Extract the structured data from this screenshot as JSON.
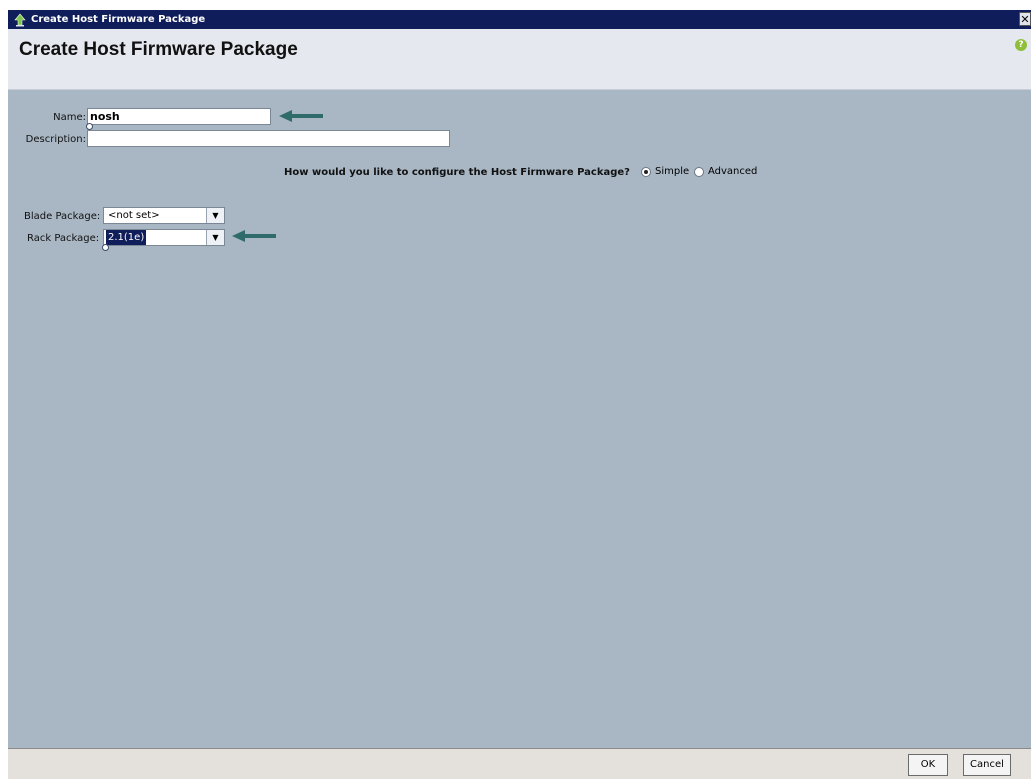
{
  "window": {
    "titlebar_text": "Create Host Firmware Package",
    "close_glyph": "✕",
    "header_title": "Create Host Firmware Package",
    "help_glyph": "?"
  },
  "form": {
    "name_label": "Name:",
    "name_value": "nosh",
    "description_label": "Description:",
    "description_value": "",
    "question": "How would you like to configure the Host Firmware Package?",
    "mode_options": [
      {
        "label": "Simple",
        "checked": true
      },
      {
        "label": "Advanced",
        "checked": false
      }
    ],
    "blade_package_label": "Blade Package:",
    "blade_package_value": "<not set>",
    "rack_package_label": "Rack Package:",
    "rack_package_value": "2.1(1e)"
  },
  "buttons": {
    "ok": "OK",
    "cancel": "Cancel"
  },
  "icons": {
    "app": "firmware-package-icon",
    "help": "help-icon",
    "arrow": "arrow-left-icon",
    "dropdown": "chevron-down-icon"
  },
  "colors": {
    "titlebar": "#0f1d5a",
    "body": "#a9b7c4",
    "header": "#e5e8ef",
    "arrow": "#2f6b6b"
  }
}
